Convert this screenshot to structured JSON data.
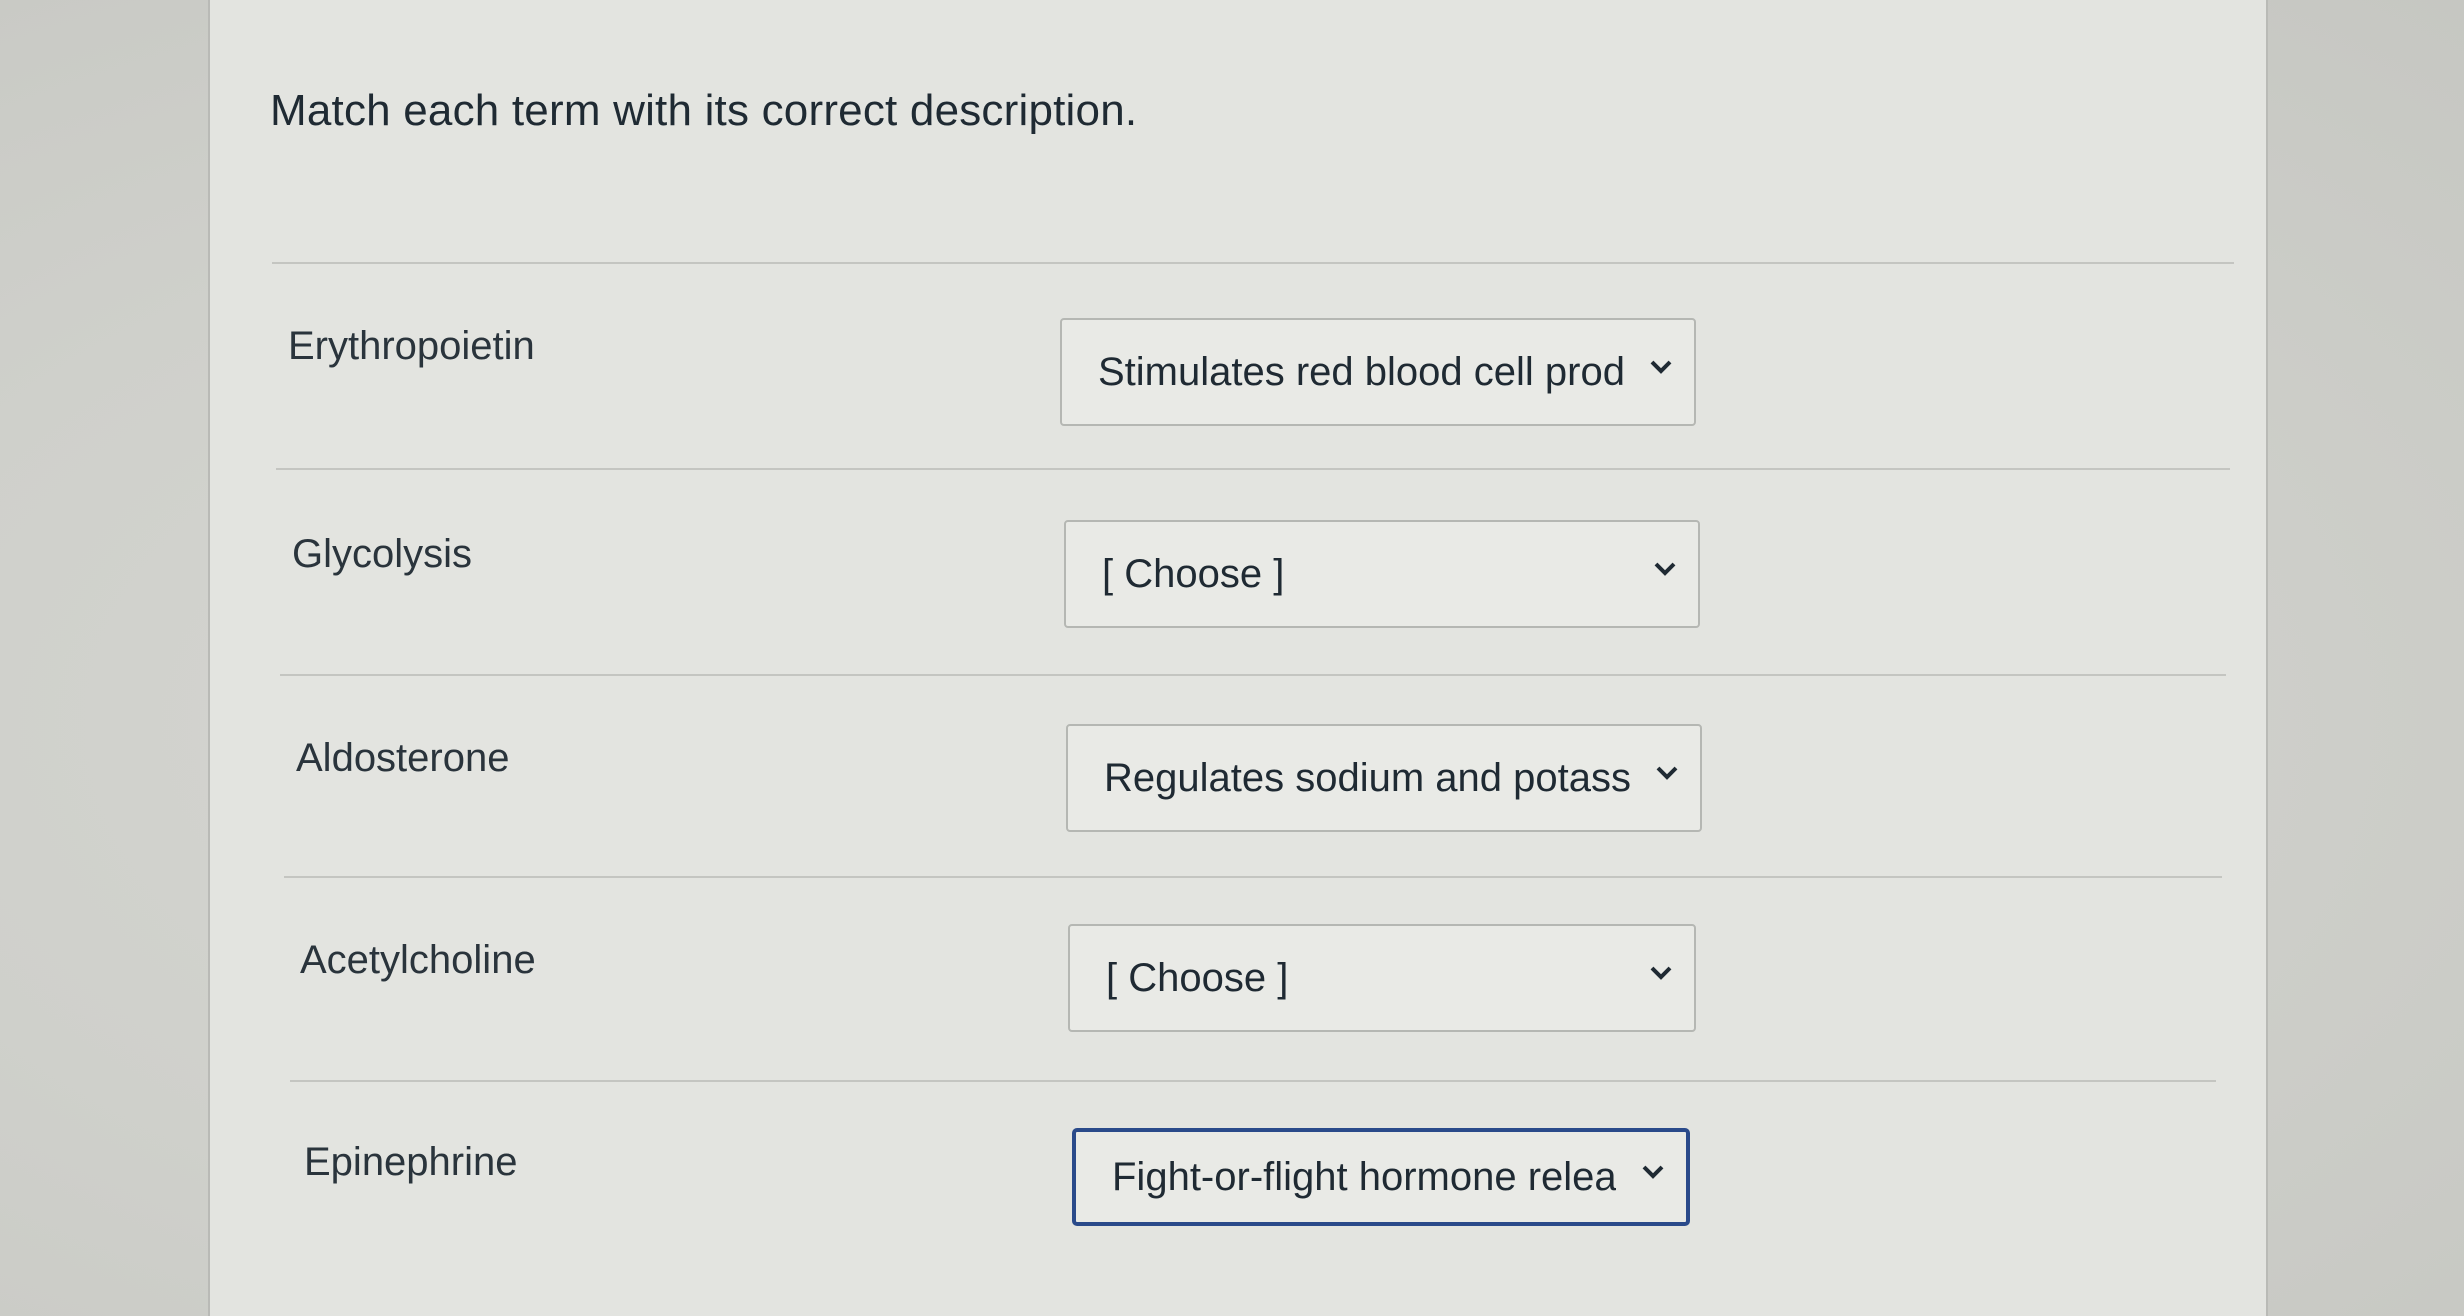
{
  "quiz": {
    "prompt": "Match each term with its correct description.",
    "rows": [
      {
        "term": "Erythropoietin",
        "selected": "Stimulates red blood cell prod"
      },
      {
        "term": "Glycolysis",
        "selected": "[ Choose ]"
      },
      {
        "term": "Aldosterone",
        "selected": "Regulates sodium and potassi"
      },
      {
        "term": "Acetylcholine",
        "selected": "[ Choose ]"
      },
      {
        "term": "Epinephrine",
        "selected": "Fight-or-flight hormone releas"
      }
    ]
  },
  "icons": {
    "dropdown": "chevron-down-icon"
  },
  "colors": {
    "focus_border": "#2a4a8a",
    "panel_bg": "#e3e4e0",
    "text": "#1f2a33"
  }
}
